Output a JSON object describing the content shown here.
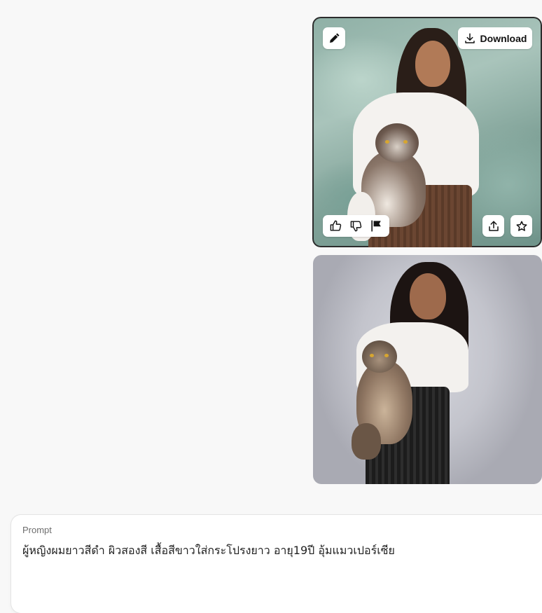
{
  "images": [
    {
      "download_label": "Download",
      "icons": {
        "edit": "pencil-icon",
        "download": "download-icon",
        "like": "thumbs-up-icon",
        "dislike": "thumbs-down-icon",
        "report": "flag-icon",
        "share": "share-icon",
        "favorite": "star-icon"
      },
      "background_color": "#8fb0a6"
    },
    {
      "background_color": "#c3c4cc"
    }
  ],
  "prompt": {
    "label": "Prompt",
    "text": "ผู้หญิงผมยาวสีดำ ผิวสองสี เสื้อสีขาวใส่กระโปรงยาว อายุ19ปี อุ้มแมวเปอร์เซีย"
  }
}
